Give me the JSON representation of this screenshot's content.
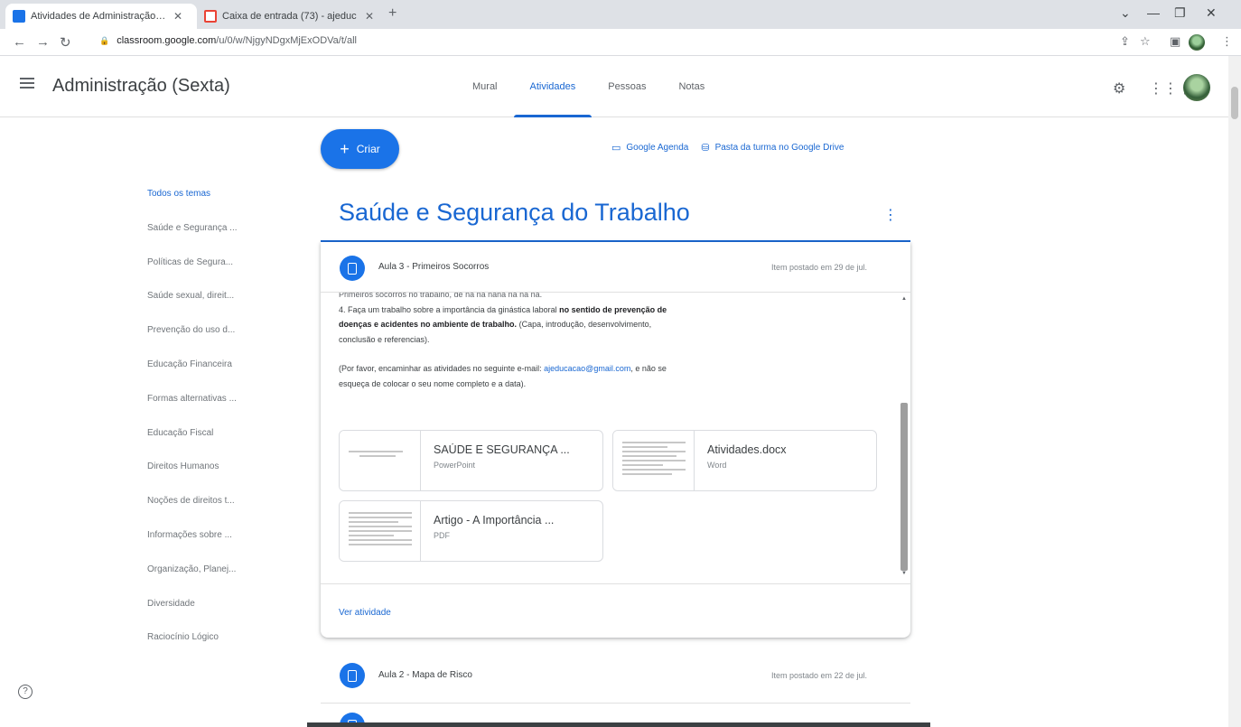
{
  "browser": {
    "tabs": [
      {
        "title": "Atividades de Administração (Se",
        "favicon_color": "#1a73e8",
        "active": true
      },
      {
        "title": "Caixa de entrada (73) - ajeduc",
        "favicon_color": "#ea4335",
        "active": false
      }
    ],
    "url_host": "classroom.google.com",
    "url_path": "/u/0/w/NjgyNDgxMjExODVa/t/all"
  },
  "header": {
    "class_title": "Administração (Sexta)",
    "nav": [
      "Mural",
      "Atividades",
      "Pessoas",
      "Notas"
    ],
    "active_nav": "Atividades"
  },
  "sidebar": {
    "topics": [
      "Todos os temas",
      "Saúde e Segurança ...",
      "Políticas de Segura...",
      "Saúde sexual, direit...",
      "Prevenção do uso d...",
      "Educação Financeira",
      "Formas alternativas ...",
      "Educação Fiscal",
      "Direitos Humanos",
      "Noções de direitos t...",
      "Informações sobre ...",
      "Organização, Planej...",
      "Diversidade",
      "Raciocínio Lógico"
    ]
  },
  "main": {
    "create_label": "Criar",
    "calendar_link": "Google Agenda",
    "drive_link": "Pasta da turma no Google Drive",
    "topic_title": "Saúde e Segurança do Trabalho",
    "topic_menu": "⋮",
    "assignment": {
      "title": "Aula 3 - Primeiros Socorros",
      "date": "Item postado em 29 de jul.",
      "desc_line0": "Primeiros socorros no trabalho, de na na nana na na na.",
      "desc_p1_a": "4. Faça um trabalho sobre a importância da ginástica laboral",
      "desc_p1_b": "no sentido de prevenção de doenças e acidentes no ambiente de trabalho.",
      "desc_p1_c": "(Capa, introdução, desenvolvimento, conclusão e referencias).",
      "desc_p2_a": "(Por favor, encaminhar as atividades no seguinte e-mail:",
      "email": "ajeducacao@gmail.com",
      "desc_p2_b": ", e não se esqueça de colocar o seu nome completo e a data).",
      "attachments": [
        {
          "name": "SAÚDE E SEGURANÇA ...",
          "type": "PowerPoint"
        },
        {
          "name": "Atividades.docx",
          "type": "Word"
        },
        {
          "name": "Artigo - A Importância ...",
          "type": "PDF"
        }
      ],
      "view_label": "Ver atividade"
    },
    "next_assignment": {
      "title": "Aula 2 - Mapa de Risco",
      "date": "Item postado em 22 de jul."
    }
  }
}
